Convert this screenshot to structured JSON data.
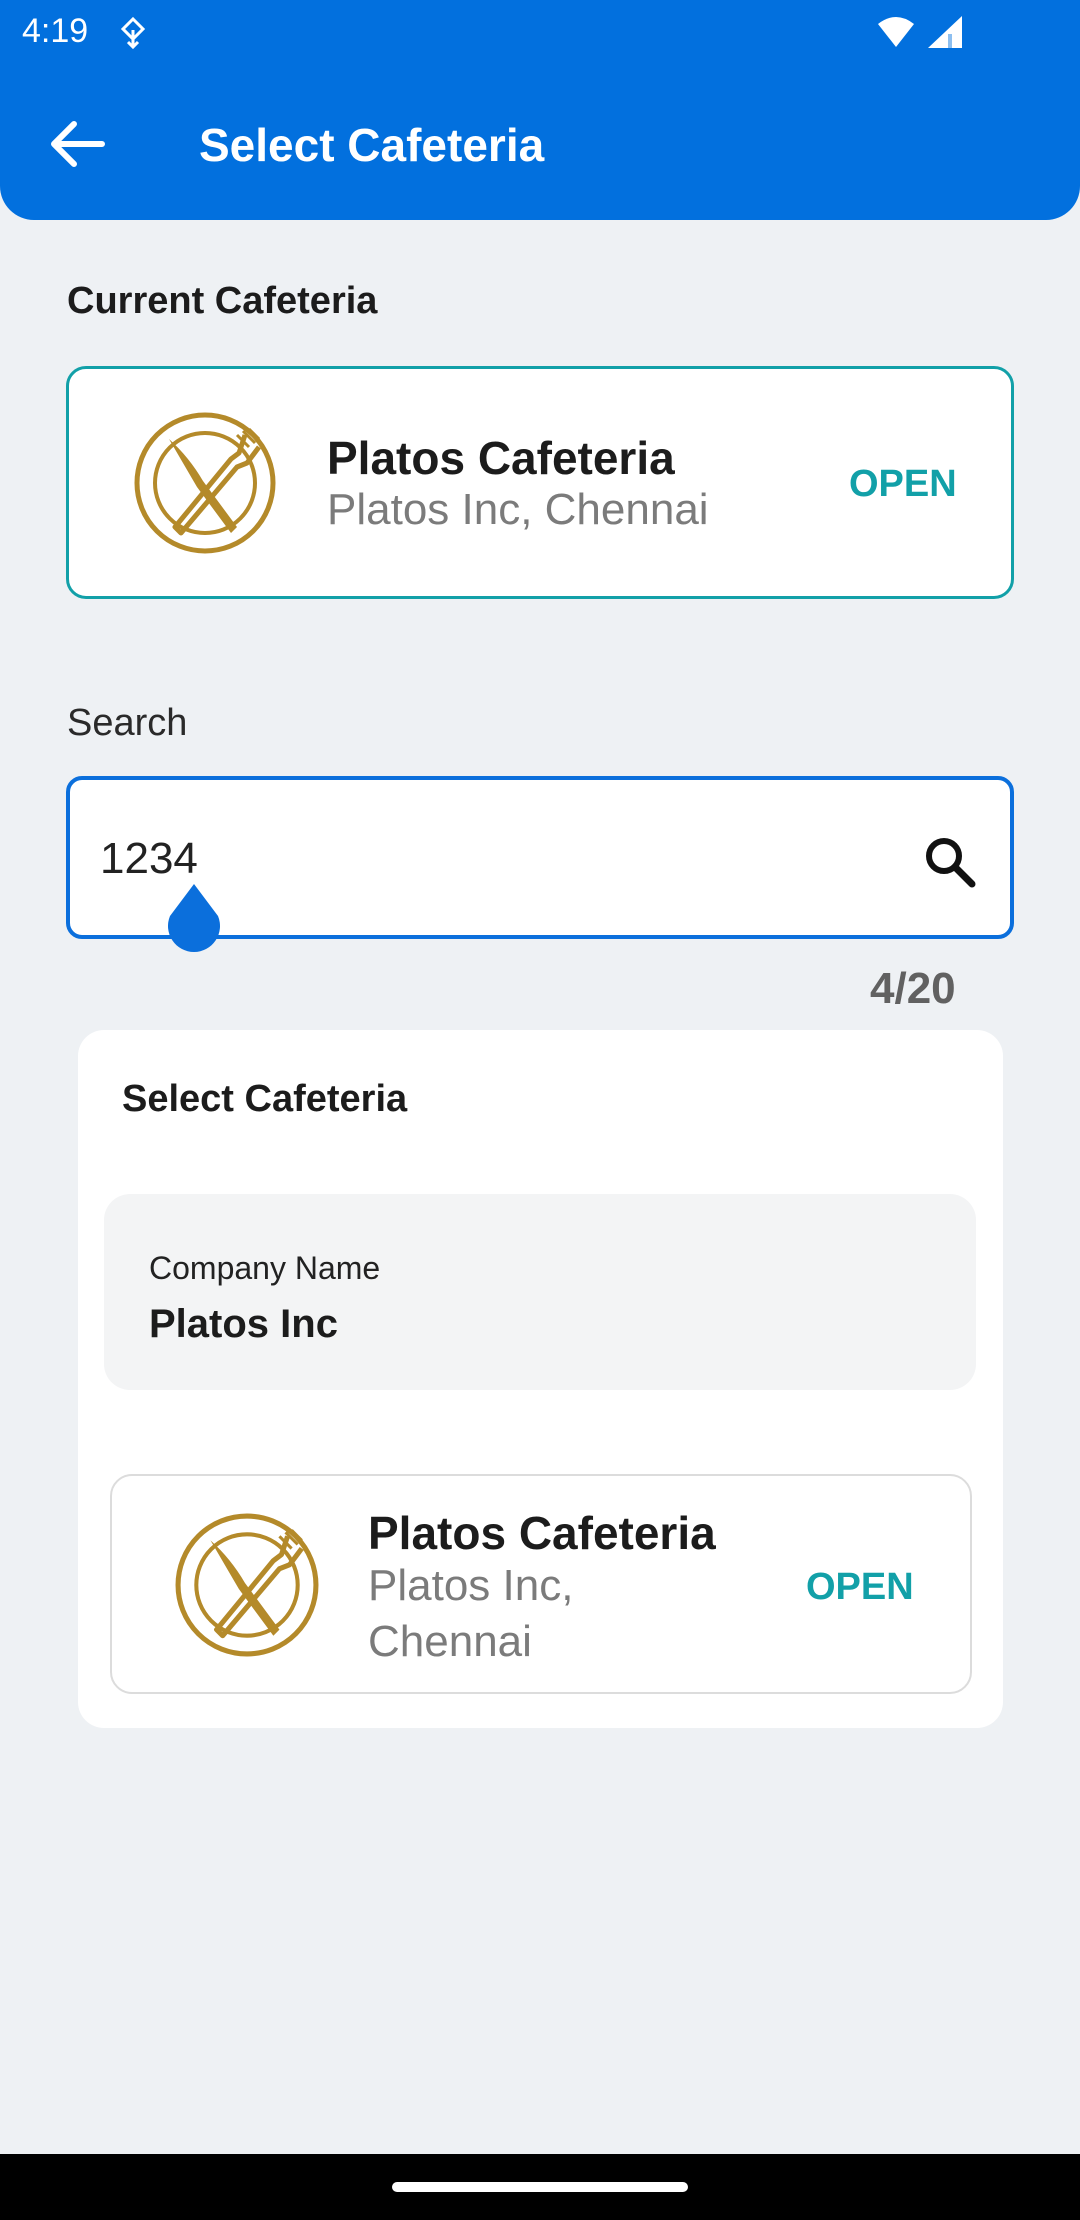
{
  "status_bar": {
    "time": "4:19"
  },
  "header": {
    "title": "Select Cafeteria"
  },
  "current_section": {
    "label": "Current Cafeteria",
    "card": {
      "name": "Platos Cafeteria",
      "location": "Platos Inc, Chennai",
      "status": "OPEN"
    }
  },
  "search": {
    "label": "Search",
    "value": "1234",
    "counter": "4/20"
  },
  "results": {
    "title": "Select Cafeteria",
    "company_label": "Company Name",
    "company_value": "Platos Inc",
    "items": [
      {
        "name": "Platos Cafeteria",
        "location": "Platos Inc, Chennai",
        "status": "OPEN"
      }
    ]
  },
  "colors": {
    "primary": "#0270de",
    "open_status": "#12a0a8",
    "logo_gold": "#b48a2a",
    "background": "#eef1f4"
  },
  "icons": [
    "back-arrow-icon",
    "search-icon",
    "cafeteria-logo-icon",
    "wifi-icon",
    "signal-icon"
  ]
}
